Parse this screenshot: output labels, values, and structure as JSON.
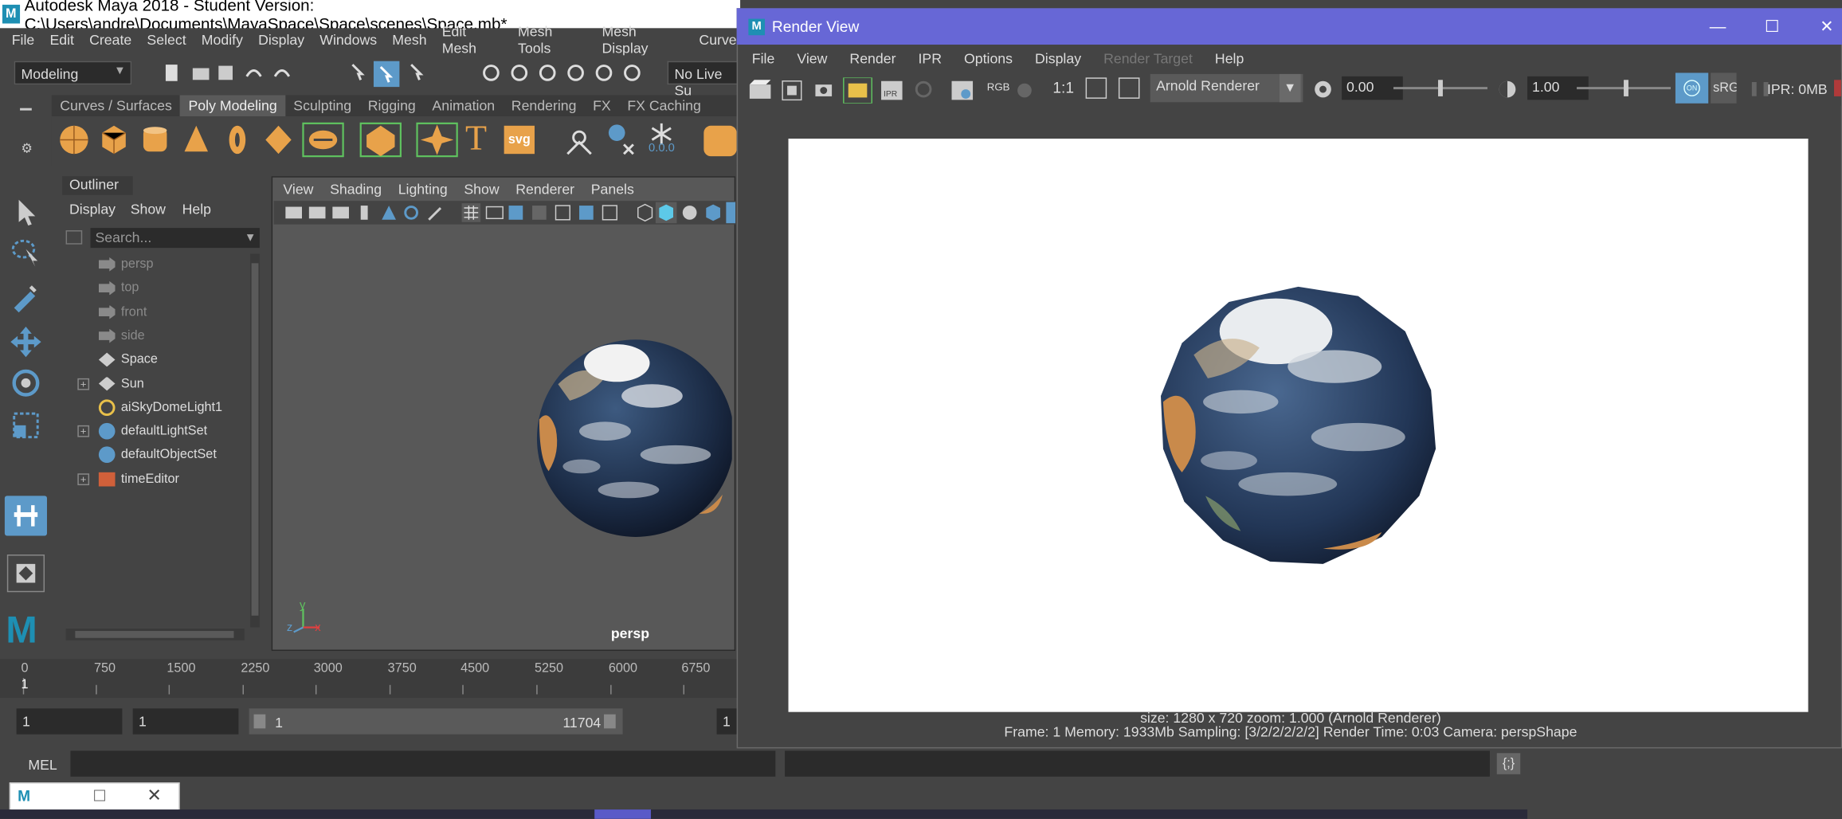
{
  "maya": {
    "title": "Autodesk Maya 2018 - Student Version: C:\\Users\\andre\\Documents\\MayaSpace\\Space\\scenes\\Space.mb*",
    "logo": "M",
    "menu": [
      "File",
      "Edit",
      "Create",
      "Select",
      "Modify",
      "Display",
      "Windows",
      "Mesh",
      "Edit Mesh",
      "Mesh Tools",
      "Mesh Display",
      "Curve"
    ],
    "menuset": "Modeling",
    "live_surface": "No Live Su",
    "shelf_tabs": [
      "Curves / Surfaces",
      "Poly Modeling",
      "Sculpting",
      "Rigging",
      "Animation",
      "Rendering",
      "FX",
      "FX Caching"
    ],
    "active_shelf_tab": "Poly Modeling",
    "shelf_text_t": "T",
    "shelf_text_svg": "svg",
    "shelf_text_num": "0.0.0"
  },
  "outliner": {
    "tab": "Outliner",
    "menu": [
      "Display",
      "Show",
      "Help"
    ],
    "search_placeholder": "Search...",
    "items": [
      {
        "label": "persp",
        "grey": true,
        "expandable": false,
        "icon": "camera-icon"
      },
      {
        "label": "top",
        "grey": true,
        "expandable": false,
        "icon": "camera-icon"
      },
      {
        "label": "front",
        "grey": true,
        "expandable": false,
        "icon": "camera-icon"
      },
      {
        "label": "side",
        "grey": true,
        "expandable": false,
        "icon": "camera-icon"
      },
      {
        "label": "Space",
        "grey": false,
        "expandable": false,
        "icon": "mesh-icon"
      },
      {
        "label": "Sun",
        "grey": false,
        "expandable": true,
        "icon": "mesh-icon"
      },
      {
        "label": "aiSkyDomeLight1",
        "grey": false,
        "expandable": false,
        "icon": "light-icon"
      },
      {
        "label": "defaultLightSet",
        "grey": false,
        "expandable": true,
        "icon": "set-icon"
      },
      {
        "label": "defaultObjectSet",
        "grey": false,
        "expandable": false,
        "icon": "set-icon"
      },
      {
        "label": "timeEditor",
        "grey": false,
        "expandable": true,
        "icon": "time-editor-icon"
      }
    ]
  },
  "viewport": {
    "menu": [
      "View",
      "Shading",
      "Lighting",
      "Show",
      "Renderer",
      "Panels"
    ],
    "camera_label": "persp",
    "axis_y": "y",
    "axis_z": "z",
    "axis_x": "x"
  },
  "timeline": {
    "ticks": [
      "0",
      "750",
      "1500",
      "2250",
      "3000",
      "3750",
      "4500",
      "5250",
      "6000",
      "6750"
    ],
    "current": "1",
    "range_start": "1",
    "range_field2": "1",
    "slider_start": "1",
    "slider_end": "11704",
    "range_end_cut": "1"
  },
  "cmd": {
    "label": "MEL"
  },
  "render_view": {
    "title": "Render View",
    "logo": "M",
    "menu": [
      "File",
      "View",
      "Render",
      "IPR",
      "Options",
      "Display",
      "Render Target",
      "Help"
    ],
    "disabled_menu": "Render Target",
    "renderer": "Arnold Renderer",
    "exposure": "0.00",
    "gamma": "1.00",
    "rgb_label": "RGB",
    "ratio_label": "1:1",
    "ipr_label": "IPR",
    "srgb_label": "sRG",
    "ipr_memory": "IPR: 0MB",
    "info_line1": "size: 1280 x 720  zoom: 1.000     (Arnold Renderer)",
    "info_line2": "Frame: 1     Memory: 1933Mb     Sampling: [3/2/2/2/2/2]     Render Time: 0:03     Camera: perspShape"
  },
  "colors": {
    "maya_bg": "#444444",
    "rv_title": "#6767d6",
    "accent_blue": "#5d9ac9",
    "orange_icon": "#e8a24a"
  }
}
